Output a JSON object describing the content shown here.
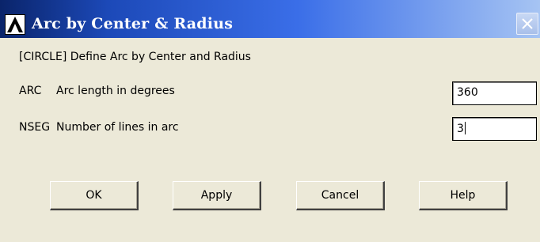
{
  "window": {
    "title": "Arc by Center & Radius",
    "title_icon": "ansys-logo-icon",
    "close_icon": "close-icon"
  },
  "heading": "[CIRCLE]  Define Arc by Center and Radius",
  "fields": [
    {
      "code": "ARC",
      "label": "Arc length in degrees",
      "value": "360"
    },
    {
      "code": "NSEG",
      "label": "Number of lines in arc",
      "value": "3"
    }
  ],
  "buttons": {
    "ok": "OK",
    "apply": "Apply",
    "cancel": "Cancel",
    "help": "Help"
  },
  "colors": {
    "titlebar_start": "#0a246a",
    "titlebar_end": "#a6c4f3",
    "dialog_bg": "#ece9d8",
    "field_bg": "#ffffff"
  }
}
